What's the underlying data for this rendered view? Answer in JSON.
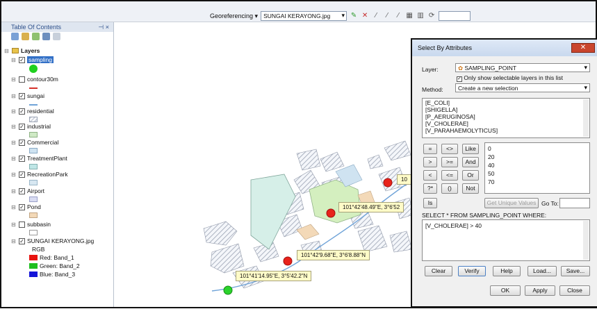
{
  "toolbar": {
    "georef_label": "Georeferencing ▾",
    "georef_layer": "SUNGAI KERAYONG.jpg"
  },
  "toc": {
    "title": "Table Of Contents",
    "pin": "⊣ ×",
    "group": "Layers",
    "layers": [
      {
        "name": "sampling",
        "checked": true
      },
      {
        "name": "contour30m",
        "checked": false
      },
      {
        "name": "sungai",
        "checked": true
      },
      {
        "name": "residential",
        "checked": true
      },
      {
        "name": "industrial",
        "checked": true
      },
      {
        "name": "Commercial",
        "checked": true
      },
      {
        "name": "TreatmentPlant",
        "checked": true
      },
      {
        "name": "RecreationPark",
        "checked": true
      },
      {
        "name": "Airport",
        "checked": true
      },
      {
        "name": "Pond",
        "checked": true
      },
      {
        "name": "subbasin",
        "checked": false
      },
      {
        "name": "SUNGAI KERAYONG.jpg",
        "checked": true
      }
    ],
    "rgb_label": "RGB",
    "bands": [
      "Red:  Band_1",
      "Green: Band_2",
      "Blue:  Band_3"
    ],
    "colors": {
      "red": "#e8130f",
      "green": "#1fbf1f",
      "blue": "#1414d8"
    }
  },
  "map": {
    "callouts": [
      "101°42'48.49\"E, 3°6'52",
      "101°42'9.68\"E, 3°6'8.88\"N",
      "101°41'14.95\"E, 3°5'42.2\"N",
      "10"
    ]
  },
  "dialog": {
    "title": "Select By Attributes",
    "layer_label": "Layer:",
    "layer_value": "SAMPLING_POINT",
    "only_selectable": "Only show selectable layers in this list",
    "method_label": "Method:",
    "method_value": "Create a new selection",
    "fields": [
      "[E_COLI]",
      "[SHIGELLA]",
      "[P_AERUGINOSA]",
      "[V_CHOLERAE]",
      "[V_PARAHAEMOLYTICUS]"
    ],
    "operators": [
      [
        "=",
        "<>",
        "Like"
      ],
      [
        ">",
        ">=",
        "And"
      ],
      [
        "<",
        "<=",
        "Or"
      ],
      [
        "?*",
        "()",
        "Not"
      ]
    ],
    "is_label": "Is",
    "values": [
      "0",
      "20",
      "40",
      "50",
      "70"
    ],
    "get_unique": "Get Unique Values",
    "goto": "Go To:",
    "sql_prefix": "SELECT * FROM SAMPLING_POINT WHERE:",
    "expression": "[V_CHOLERAE] > 40",
    "buttons": {
      "clear": "Clear",
      "verify": "Verify",
      "help": "Help",
      "load": "Load...",
      "save": "Save...",
      "ok": "OK",
      "apply": "Apply",
      "close": "Close"
    }
  }
}
